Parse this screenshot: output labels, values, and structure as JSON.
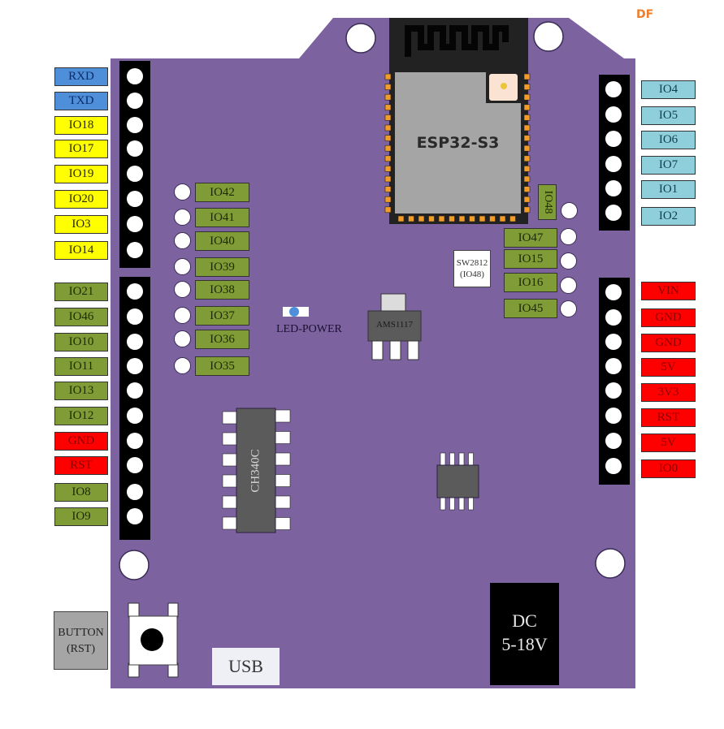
{
  "watermark": "DF",
  "board": {
    "module_label": "ESP32-S3",
    "colors": {
      "pcb": "#7d62a0",
      "label_blue": "#4f8fd9",
      "label_yellow": "#ffff00",
      "label_green": "#7f9c36",
      "label_cyan": "#8fcfdc",
      "label_red": "#ff0000",
      "pad_orange": "#f39c28"
    },
    "left_header_top": [
      "RXD",
      "TXD",
      "IO18",
      "IO17",
      "IO19",
      "IO20",
      "IO3",
      "IO14"
    ],
    "left_header_bottom": [
      "IO21",
      "IO46",
      "IO10",
      "IO11",
      "IO13",
      "IO12",
      "GND",
      "RST",
      "IO8",
      "IO9"
    ],
    "right_header_top": [
      "IO4",
      "IO5",
      "IO6",
      "IO7",
      "IO1",
      "IO2"
    ],
    "right_header_bottom": [
      "VIN",
      "GND",
      "GND",
      "5V",
      "3V3",
      "RST",
      "5V",
      "IO0"
    ],
    "inner_left_pins": [
      "IO42",
      "IO41",
      "IO40",
      "IO39",
      "IO38",
      "IO37",
      "IO36",
      "IO35"
    ],
    "inner_right_pins": [
      "IO47",
      "IO15",
      "IO16",
      "IO45"
    ],
    "io48_vertical": "IO48",
    "ws2812_label_line1": "SW2812",
    "ws2812_label_line2": "(IO48)",
    "led_label": "LED-POWER",
    "regulator_label": "AMS1117",
    "usb_chip_label": "CH340C",
    "button_label_line1": "BUTTON",
    "button_label_line2": "(RST)",
    "usb_label": "USB",
    "dc_label_line1": "DC",
    "dc_label_line2": "5-18V"
  }
}
